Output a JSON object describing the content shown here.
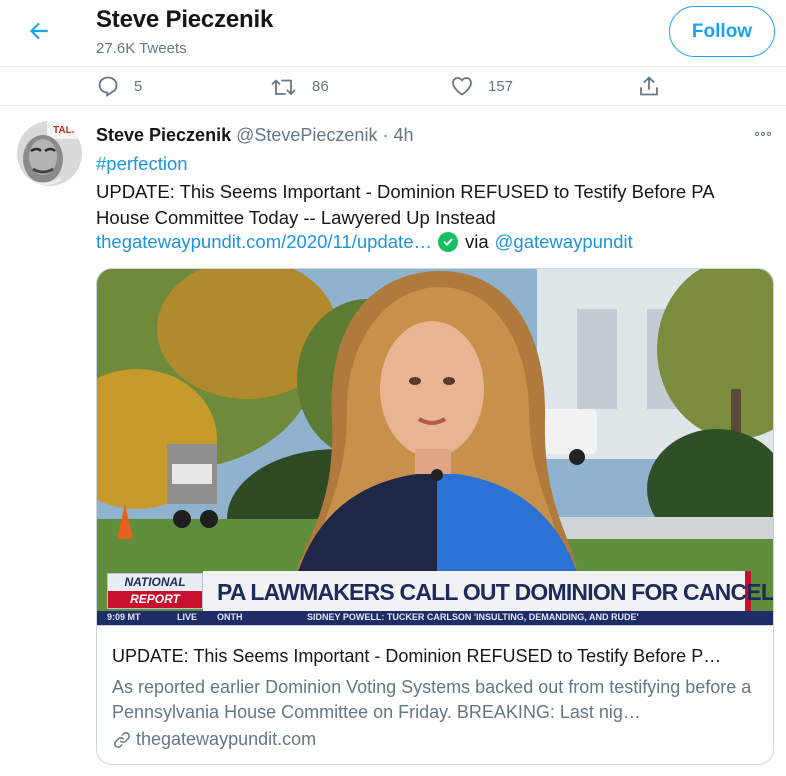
{
  "header": {
    "name": "Steve Pieczenik",
    "tweet_count": "27.6K Tweets",
    "follow_label": "Follow"
  },
  "prev_tweet": {
    "replies": "5",
    "retweets": "86",
    "likes": "157"
  },
  "tweet": {
    "author_name": "Steve Pieczenik",
    "author_handle": "@StevePieczenik · 4h",
    "hashtag": "#perfection",
    "text": "UPDATE: This Seems Important - Dominion REFUSED to Testify Before PA House Committee Today -- Lawyered Up Instead",
    "link": "thegatewaypundit.com/2020/11/update…",
    "via": "via",
    "via_handle": "@gatewaypundit",
    "avatar_sign": "TALK"
  },
  "card": {
    "title": "UPDATE: This Seems Important - Dominion REFUSED to Testify Before P…",
    "description": "As reported earlier Dominion Voting Systems backed out from testifying before a Pennsylvania House Committee on Friday. BREAKING: Last nig…",
    "domain": "thegatewaypundit.com",
    "lower_third": {
      "logo_line1": "NATIONAL",
      "logo_line2": "REPORT",
      "headline": "PA LAWMAKERS CALL OUT DOMINION FOR CANCELING HEARING",
      "time": "9:09 MT",
      "live": "LIVE",
      "ticker": "SIDNEY POWELL: TUCKER CARLSON 'INSULTING, DEMANDING, AND RUDE'",
      "ticker_prefix": "ONTH"
    }
  },
  "colors": {
    "accent": "#1da1f2",
    "link": "#1b95e0",
    "secondary_text": "#657786",
    "verified": "#17bf63"
  }
}
